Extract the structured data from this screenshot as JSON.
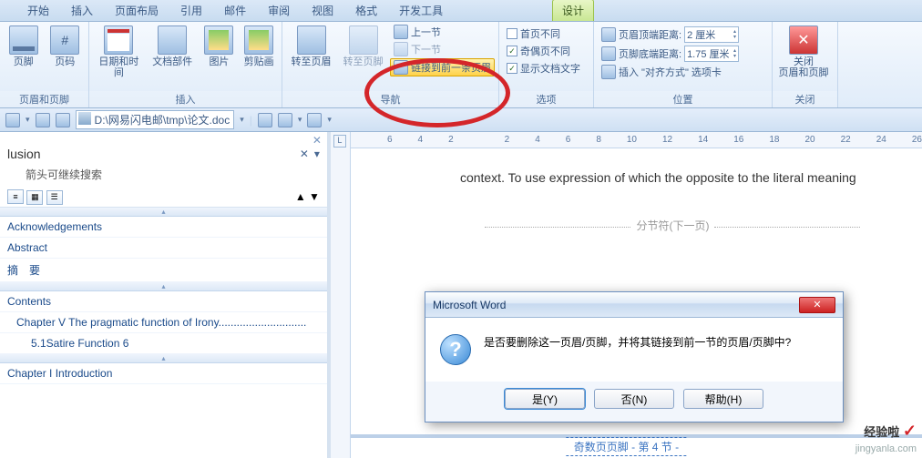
{
  "tabs": [
    "开始",
    "插入",
    "页面布局",
    "引用",
    "邮件",
    "审阅",
    "视图",
    "格式",
    "开发工具"
  ],
  "context_tab": "设计",
  "ribbon": {
    "g1": {
      "label": "页眉和页脚",
      "footer": "页脚",
      "pagenum": "页码"
    },
    "g2": {
      "label": "插入",
      "datetime": "日期和时间",
      "docparts": "文档部件",
      "pic": "图片",
      "clip": "剪贴画"
    },
    "g3": {
      "label": "导航",
      "goto_hdr": "转至页眉",
      "goto_ftr": "转至页脚",
      "prev": "上一节",
      "next": "下一节",
      "link": "链接到前一条页眉"
    },
    "g4": {
      "label": "选项",
      "diff_first": "首页不同",
      "diff_odd": "奇偶页不同",
      "show_doc": "显示文档文字"
    },
    "g5": {
      "label": "位置",
      "hdr_dist": "页眉顶端距离:",
      "hdr_val": "2 厘米",
      "ftr_dist": "页脚底端距离:",
      "ftr_val": "1.75 厘米",
      "align": "插入 \"对齐方式\" 选项卡"
    },
    "g6": {
      "label": "关闭",
      "close": "关闭\n页眉和页脚"
    }
  },
  "qat": {
    "path": "D:\\网易闪电邮\\tmp\\论文.doc"
  },
  "nav": {
    "title": "lusion",
    "hint": "箭头可继续搜索",
    "items": [
      {
        "t": "Acknowledgements",
        "lv": 0
      },
      {
        "t": "Abstract",
        "lv": 0
      },
      {
        "t": "摘　要",
        "lv": 0
      },
      {
        "t": "Contents",
        "lv": 0
      },
      {
        "t": "Chapter V The pragmatic function of Irony.............................",
        "lv": 1
      },
      {
        "t": "5.1Satire Function 6",
        "lv": 2
      },
      {
        "t": "Chapter I Introduction",
        "lv": 0
      }
    ]
  },
  "ruler": [
    "6",
    "4",
    "2",
    "",
    "2",
    "4",
    "6",
    "8",
    "10",
    "12",
    "14",
    "16",
    "18",
    "20",
    "22",
    "24",
    "26"
  ],
  "doc_line": "context. To use expression of which the opposite to the literal meaning",
  "section_break": "分节符(下一页)",
  "footer_mark": "奇数页页脚 - 第 4 节 -",
  "dialog": {
    "title": "Microsoft Word",
    "msg": "是否要删除这一页眉/页脚，并将其链接到前一节的页眉/页脚中?",
    "yes": "是(Y)",
    "no": "否(N)",
    "help": "帮助(H)"
  },
  "watermark": {
    "brand": "经验啦",
    "check": "✓",
    "url": "jingyanla.com"
  }
}
